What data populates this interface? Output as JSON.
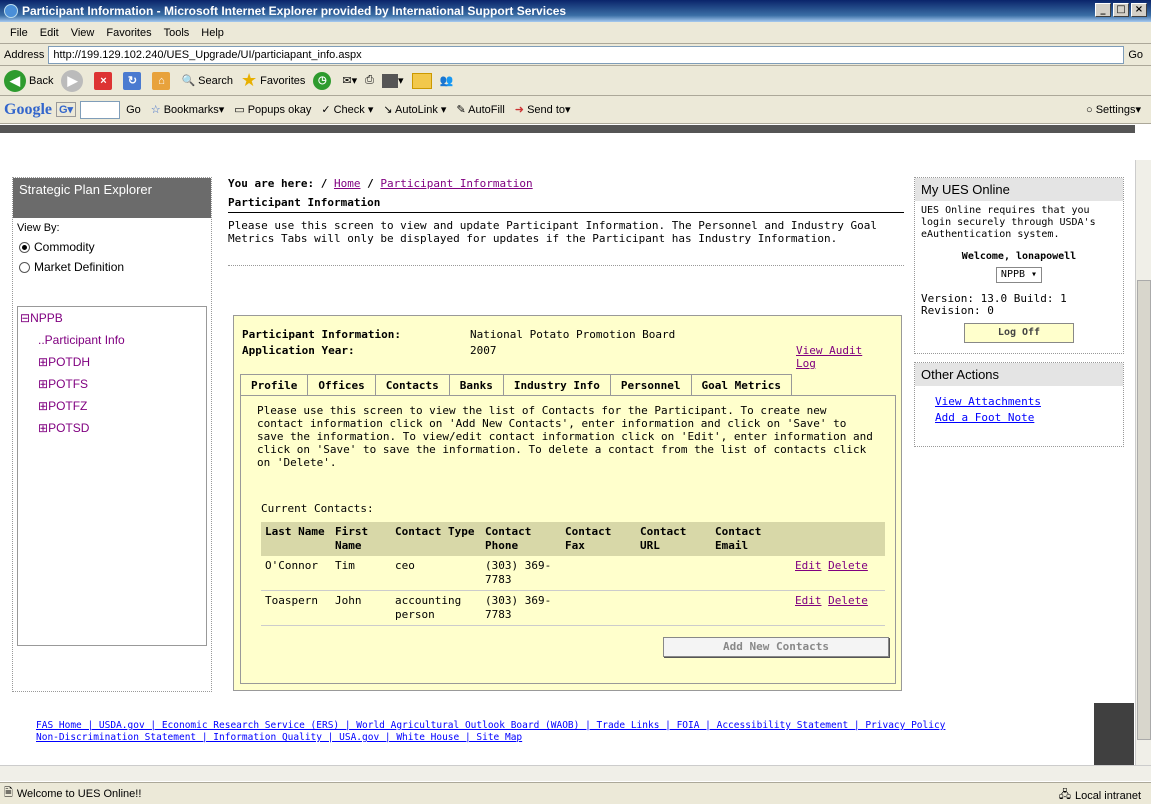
{
  "window": {
    "title": "Participant Information - Microsoft Internet Explorer provided by International Support Services"
  },
  "menu": [
    "File",
    "Edit",
    "View",
    "Favorites",
    "Tools",
    "Help"
  ],
  "address": {
    "label": "Address",
    "url": "http://199.129.102.240/UES_Upgrade/UI/particiapant_info.aspx",
    "go": "Go"
  },
  "toolbar": {
    "back": "Back",
    "search": "Search",
    "favorites": "Favorites"
  },
  "google": {
    "logo": "Google",
    "go": "Go",
    "bookmarks": "Bookmarks▾",
    "popups": "Popups okay",
    "check": "Check ▾",
    "autolink": "AutoLink ▾",
    "autofill": "AutoFill",
    "sendto": "Send to▾",
    "settings": "Settings▾"
  },
  "left": {
    "title": "Strategic Plan Explorer",
    "viewby": "View By:",
    "opt1": "Commodity",
    "opt2": "Market Definition",
    "tree": [
      "NPPB",
      "Participant Info",
      "POTDH",
      "POTFS",
      "POTFZ",
      "POTSD"
    ]
  },
  "main": {
    "you_are_here": "You are here:",
    "crumb_home": "Home",
    "crumb_pi": "Participant Information",
    "title": "Participant Information",
    "intro": "Please use this screen to view and update Participant Information. The Personnel and Industry Goal Metrics Tabs will only be displayed for updates if the Participant has Industry Information."
  },
  "info": {
    "pi_label": "Participant Information:",
    "pi_value": "National Potato Promotion Board",
    "year_label": "Application Year:",
    "year_value": "2007",
    "audit": "View Audit Log"
  },
  "tabs": [
    "Profile",
    "Offices",
    "Contacts",
    "Banks",
    "Industry Info",
    "Personnel",
    "Goal Metrics"
  ],
  "contacts": {
    "instructions": "Please use this screen to view the list of Contacts for the Participant. To create new contact information click on 'Add New Contacts', enter information and click on 'Save' to save the information. To view/edit contact information click on 'Edit', enter information and click on 'Save' to save the information. To delete a contact from the list of contacts click on 'Delete'.",
    "current": "Current Contacts:",
    "headers": [
      "Last Name",
      "First Name",
      "Contact Type",
      "Contact Phone",
      "Contact Fax",
      "Contact URL",
      "Contact Email"
    ],
    "rows": [
      [
        "O'Connor",
        "Tim",
        "ceo",
        "(303) 369-7783",
        "",
        "",
        ""
      ],
      [
        "Toaspern",
        "John",
        "accounting person",
        "(303) 369-7783",
        "",
        "",
        ""
      ]
    ],
    "edit": "Edit",
    "delete": "Delete",
    "add": "Add New Contacts"
  },
  "right": {
    "title": "My UES Online",
    "desc": "UES Online requires that you login securely through USDA's eAuthentication system.",
    "welcome": "Welcome, lonapowell",
    "org": "NPPB",
    "version": "Version: 13.0 Build: 1 Revision: 0",
    "logoff": "Log Off",
    "other": "Other Actions",
    "attachments": "View Attachments",
    "footnote": "Add a Foot Note"
  },
  "footer": {
    "line1": "FAS Home | USDA.gov | Economic Research Service (ERS) | World Agricultural Outlook Board (WAOB) | Trade Links | FOIA | Accessibility Statement | Privacy Policy",
    "line2": "Non-Discrimination Statement | Information Quality | USA.gov | White House | Site Map"
  },
  "status": {
    "text": "Welcome to UES Online!!",
    "zone": "Local intranet"
  }
}
